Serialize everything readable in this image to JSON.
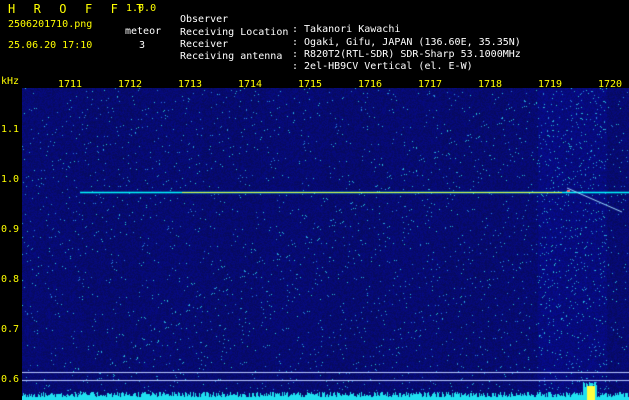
{
  "header": {
    "brand": "H R O F F T",
    "version": "1.0.0",
    "filename": "2506201710.png",
    "datetime": "25.06.20 17:10",
    "meteor_label": "meteor",
    "meteor_count": "3"
  },
  "info": [
    {
      "key": "Observer",
      "value": ": Takanori Kawachi"
    },
    {
      "key": "Receiving Location",
      "value": ": Ogaki, Gifu, JAPAN (136.60E, 35.35N)"
    },
    {
      "key": "Receiver",
      "value": ": R820T2(RTL-SDR) SDR-Sharp 53.1000MHz"
    },
    {
      "key": "Receiving antenna",
      "value": ": 2el-HB9CV Vertical (el. E-W)"
    }
  ],
  "axis": {
    "y_unit": "kHz",
    "x_ticks": [
      "1711",
      "1712",
      "1713",
      "1714",
      "1715",
      "1716",
      "1717",
      "1718",
      "1719",
      "1720"
    ],
    "y_ticks": [
      "1.1",
      "1.0",
      "0.9",
      "0.8",
      "0.7",
      "0.6"
    ]
  },
  "colors": {
    "background": "#000000",
    "label": "#ffff00",
    "text": "#ffffff",
    "spectrum": "#0a0f6e",
    "carrier": "#00ffff"
  }
}
